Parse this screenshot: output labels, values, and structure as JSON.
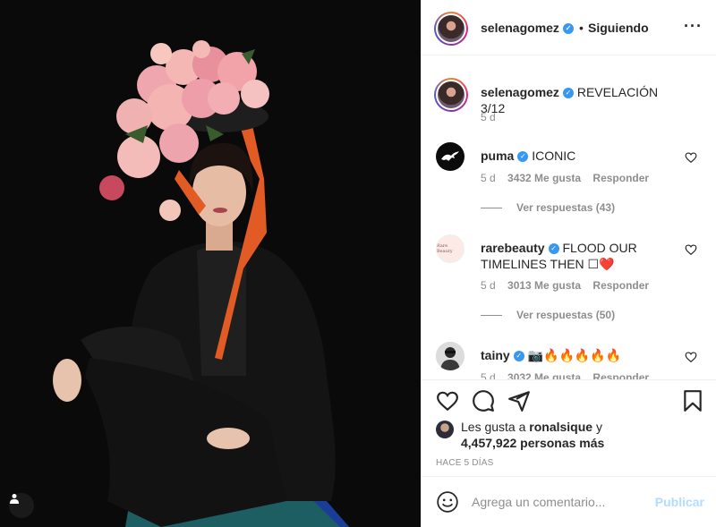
{
  "post": {
    "username": "selenagomez",
    "follow_separator": "•",
    "follow_status": "Siguiendo",
    "caption": "REVELACIÓN 3/12",
    "caption_time": "5 d"
  },
  "comments": [
    {
      "username": "puma",
      "text": "ICONIC",
      "time": "5 d",
      "likes": "3432 Me gusta",
      "reply_label": "Responder",
      "view_replies": "Ver respuestas (43)"
    },
    {
      "username": "rarebeauty",
      "text": "FLOOD OUR TIMELINES THEN ☐❤️",
      "time": "5 d",
      "likes": "3013 Me gusta",
      "reply_label": "Responder",
      "view_replies": "Ver respuestas (50)",
      "avatar_text": "Rare Beauty"
    },
    {
      "username": "tainy",
      "text": "📷🔥🔥🔥🔥🔥",
      "time": "5 d",
      "likes": "3032 Me gusta",
      "reply_label": "Responder"
    }
  ],
  "likes": {
    "prefix": "Les gusta a",
    "user": "ronalsique",
    "suffix": "y",
    "others": "4,457,922 personas más"
  },
  "time_ago": "HACE 5 DÍAS",
  "add_comment": {
    "placeholder": "Agrega un comentario...",
    "publish_label": "Publicar"
  },
  "colors": {
    "verified": "#3897f0",
    "publish_disabled": "#b3dbff",
    "secondary_text": "#8e8e8e"
  }
}
